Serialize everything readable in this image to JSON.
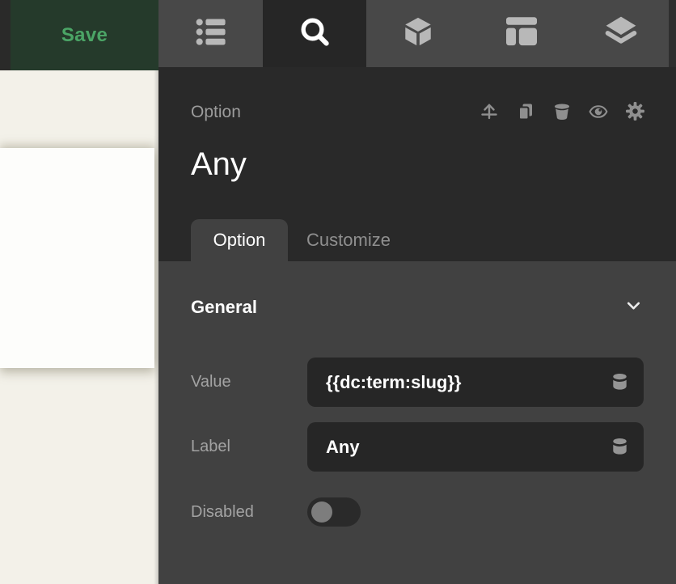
{
  "topbar": {
    "save_label": "Save",
    "tabs": [
      {
        "name": "structure",
        "icon": "list-icon",
        "active": false
      },
      {
        "name": "search",
        "icon": "search-icon",
        "active": true
      },
      {
        "name": "elements",
        "icon": "cube-icon",
        "active": false
      },
      {
        "name": "layout",
        "icon": "layout-icon",
        "active": false
      },
      {
        "name": "layers",
        "icon": "layers-icon",
        "active": false
      }
    ]
  },
  "panel": {
    "element_type_label": "Option",
    "element_title": "Any",
    "header_actions": [
      {
        "icon": "move-up-icon"
      },
      {
        "icon": "duplicate-icon"
      },
      {
        "icon": "trash-icon"
      },
      {
        "icon": "eye-icon"
      },
      {
        "icon": "gear-icon"
      }
    ],
    "tabs": [
      {
        "label": "Option",
        "active": true
      },
      {
        "label": "Customize",
        "active": false
      }
    ],
    "sections": [
      {
        "title": "General",
        "collapsed": false,
        "fields": [
          {
            "label": "Value",
            "type": "text",
            "value": "{{dc:term:slug}}",
            "dynamic_data_icon": "database-icon"
          },
          {
            "label": "Label",
            "type": "text",
            "value": "Any",
            "dynamic_data_icon": "database-icon"
          },
          {
            "label": "Disabled",
            "type": "toggle",
            "value": false
          }
        ]
      }
    ]
  },
  "colors": {
    "save_button_bg": "#253a2b",
    "save_button_text": "#4ba566",
    "topbar_tab_bg": "#484848",
    "panel_header_bg": "#292929",
    "panel_body_bg": "#414141",
    "input_bg": "#262626",
    "canvas_bg": "#f3f1e9",
    "canvas_card_bg": "#fdfdfb"
  }
}
